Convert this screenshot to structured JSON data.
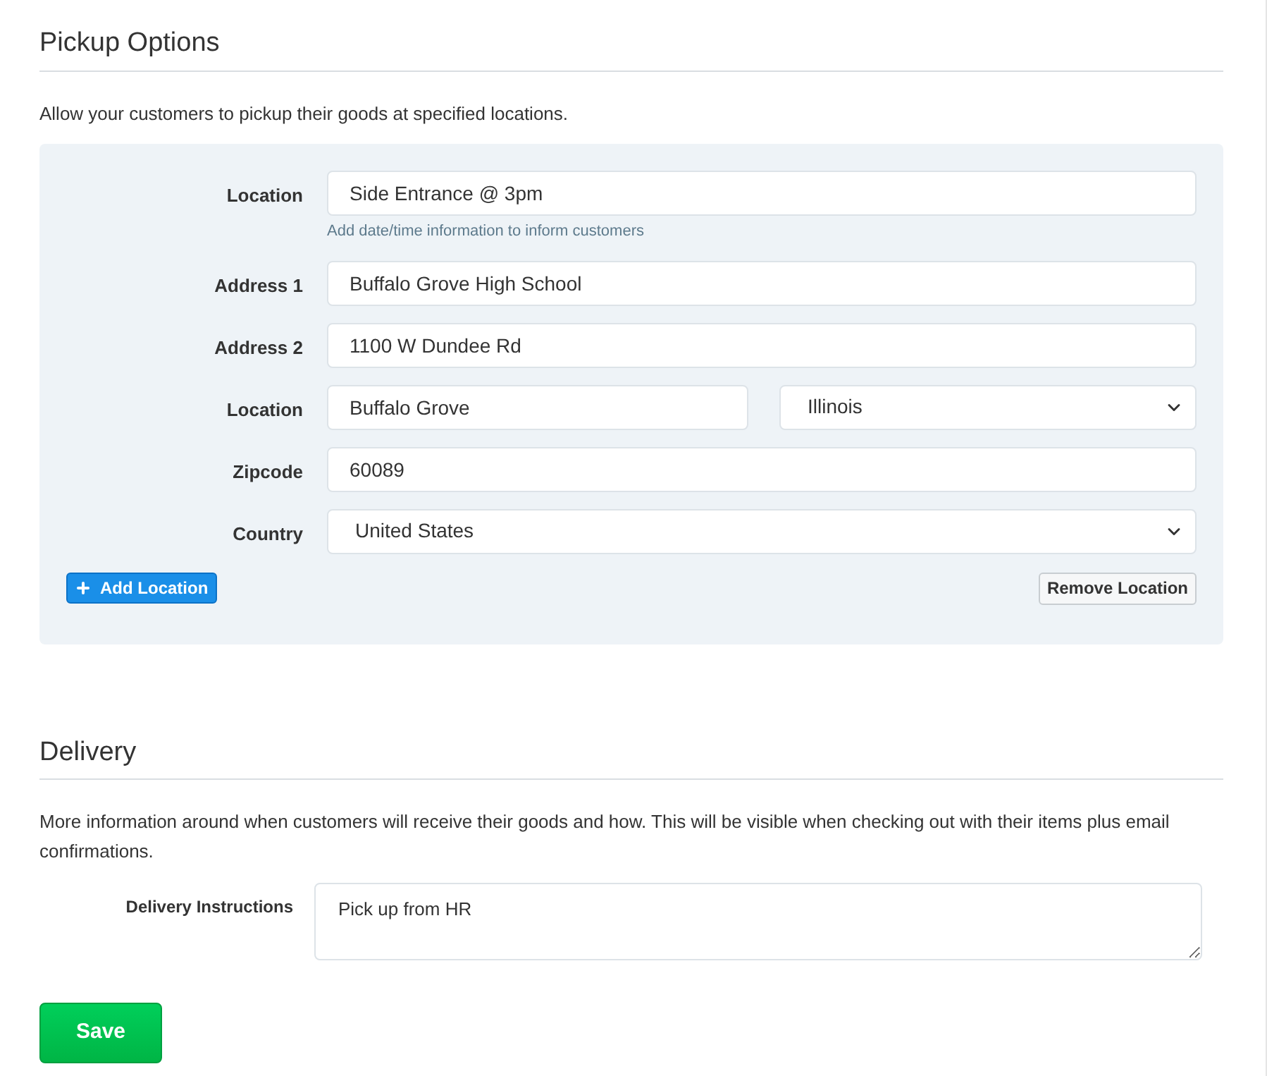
{
  "pickup": {
    "title": "Pickup Options",
    "description": "Allow your customers to pickup their goods at specified locations.",
    "fields": [
      {
        "kind": "text",
        "label": "Location",
        "value": "Side Entrance @ 3pm",
        "hint": "Add date/time information to inform customers"
      },
      {
        "kind": "text",
        "label": "Address 1",
        "value": "Buffalo Grove High School"
      },
      {
        "kind": "text",
        "label": "Address 2",
        "value": "1100 W Dundee Rd"
      },
      {
        "kind": "split",
        "label": "Location",
        "value": "Buffalo Grove",
        "select": "Illinois"
      },
      {
        "kind": "text",
        "label": "Zipcode",
        "value": "60089"
      },
      {
        "kind": "select",
        "label": "Country",
        "select": "United States"
      }
    ],
    "add_button": "Add Location",
    "remove_button": "Remove Location"
  },
  "delivery": {
    "title": "Delivery",
    "description": "More information around when customers will receive their goods and how. This will be visible when checking out with their items plus email confirmations.",
    "label": "Delivery Instructions",
    "value": "Pick up from HR"
  },
  "save_button": "Save"
}
